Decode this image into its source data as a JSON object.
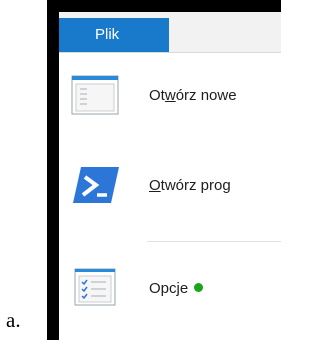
{
  "caption": "a.",
  "ribbon": {
    "file_tab_label": "Plik"
  },
  "menu": {
    "items": [
      {
        "id": "open-new-window",
        "icon": "new-window-icon",
        "label_before": "Ot",
        "label_underline": "w",
        "label_after": "órz nowe"
      },
      {
        "id": "open-powershell",
        "icon": "powershell-icon",
        "label_before": "",
        "label_underline": "O",
        "label_after": "twórz prog"
      },
      {
        "id": "options",
        "icon": "options-icon",
        "label_before": "Opcje",
        "label_underline": "",
        "label_after": ""
      }
    ]
  },
  "colors": {
    "accent": "#1979ca",
    "status_green": "#16a616",
    "powershell_blue": "#2b76d6"
  }
}
